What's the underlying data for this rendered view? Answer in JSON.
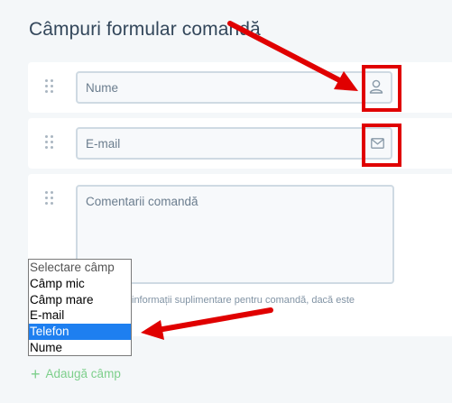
{
  "page": {
    "title": "Câmpuri formular comandă"
  },
  "fields": [
    {
      "placeholder": "Nume",
      "icon": "user-icon"
    },
    {
      "placeholder": "E-mail",
      "icon": "envelope-icon"
    },
    {
      "placeholder": "Comentarii comandă",
      "hint": "informații suplimentare pentru comandă, dacă este"
    }
  ],
  "select": {
    "options": [
      "Selectare câmp",
      "Câmp mic",
      "Câmp mare",
      "E-mail",
      "Telefon",
      "Nume"
    ],
    "selected": "Telefon"
  },
  "add_field": {
    "label": "Adaugă câmp"
  },
  "colors": {
    "accent_green": "#7dcf8b",
    "highlight_red": "#e00000",
    "selection_blue": "#1e7ff0"
  }
}
